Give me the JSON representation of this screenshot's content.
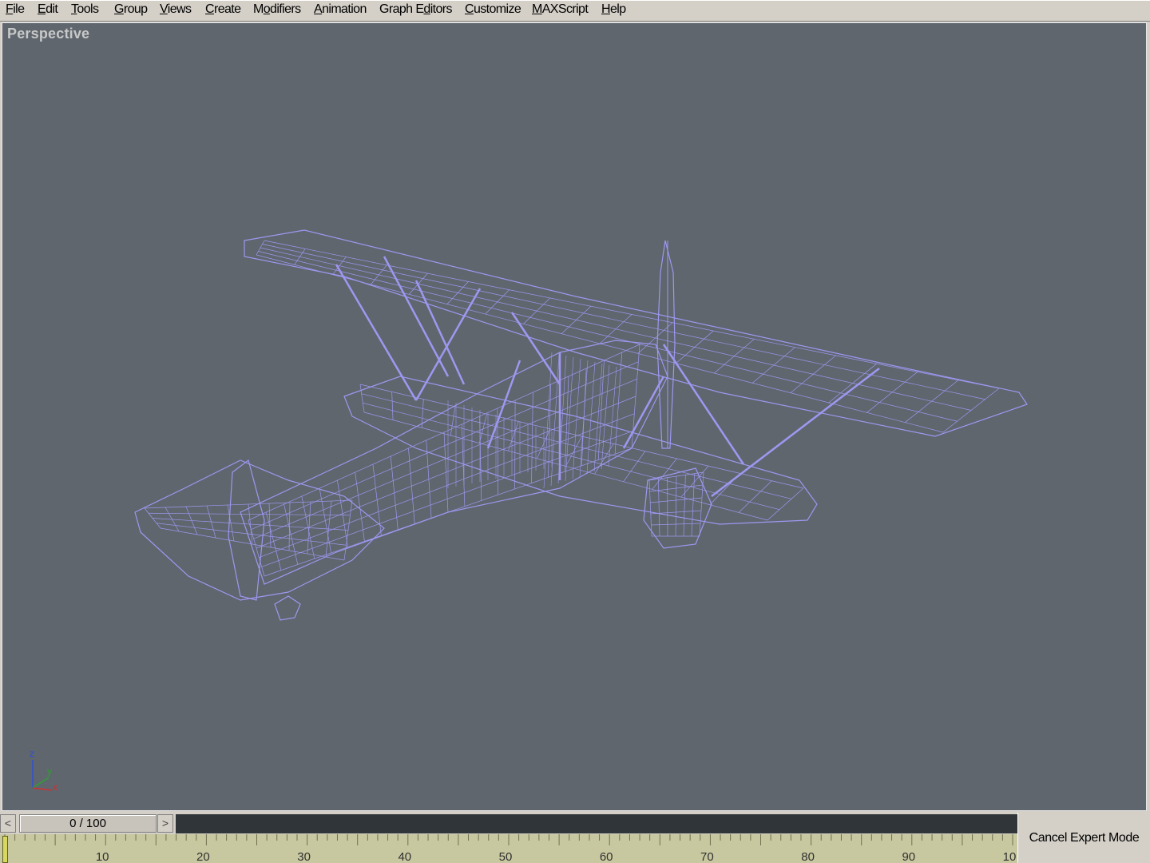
{
  "menubar": {
    "items": [
      {
        "pre": "",
        "acc": "F",
        "post": "ile"
      },
      {
        "pre": "",
        "acc": "E",
        "post": "dit"
      },
      {
        "pre": "",
        "acc": "T",
        "post": "ools"
      },
      {
        "pre": "",
        "acc": "G",
        "post": "roup"
      },
      {
        "pre": "",
        "acc": "V",
        "post": "iews"
      },
      {
        "pre": "",
        "acc": "C",
        "post": "reate"
      },
      {
        "pre": "M",
        "acc": "o",
        "post": "difiers"
      },
      {
        "pre": "",
        "acc": "A",
        "post": "nimation"
      },
      {
        "pre": "Graph E",
        "acc": "d",
        "post": "itors"
      },
      {
        "pre": "",
        "acc": "C",
        "post": "ustomize"
      },
      {
        "pre": "",
        "acc": "M",
        "post": "AXScript"
      },
      {
        "pre": "",
        "acc": "H",
        "post": "elp"
      }
    ]
  },
  "viewport": {
    "label": "Perspective",
    "background": "#5f666e",
    "wire_color": "#9f97f0",
    "object_icon": "biplane-wireframe"
  },
  "axis": {
    "z": "z",
    "y": "y",
    "x": "x",
    "x_color": "#d03030",
    "y_color": "#30a030",
    "z_color": "#3050d0"
  },
  "timeslider": {
    "display": "0 / 100",
    "current_frame": 0,
    "total_frames": 100,
    "prev_icon": "chevron-left-icon",
    "next_icon": "chevron-right-icon",
    "prev_glyph": "<",
    "next_glyph": ">"
  },
  "trackbar": {
    "tick_labels": [
      "10",
      "20",
      "30",
      "40",
      "50",
      "60",
      "70",
      "80",
      "90",
      "10"
    ]
  },
  "buttons": {
    "cancel_expert": "Cancel Expert Mode"
  }
}
